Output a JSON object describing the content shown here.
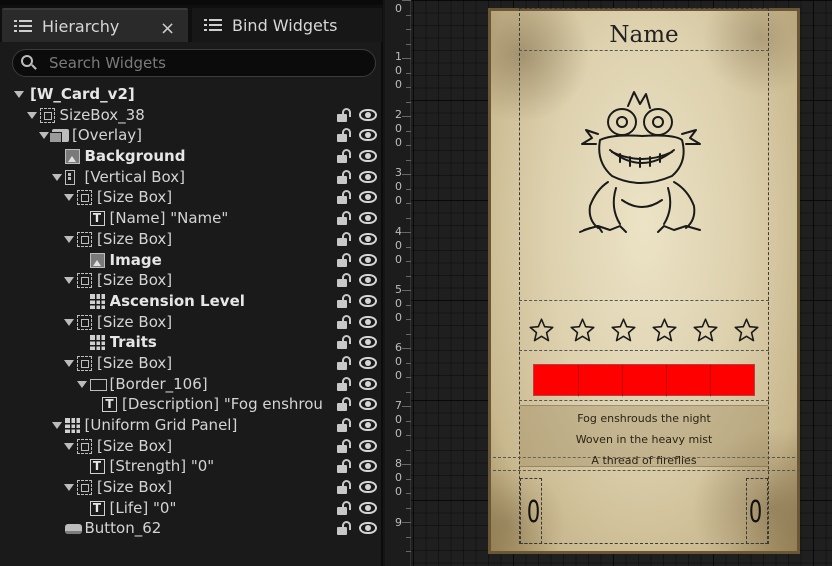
{
  "tabs": {
    "hierarchy": "Hierarchy",
    "bind_widgets": "Bind Widgets",
    "close_symbol": "×"
  },
  "search": {
    "placeholder": "Search Widgets"
  },
  "tree": [
    {
      "label": "[W_Card_v2]",
      "bold": true,
      "indent": 0,
      "icon": "",
      "arrow": true,
      "vis": false
    },
    {
      "label": "SizeBox_38",
      "bold": false,
      "indent": 1,
      "icon": "sizebox-icon",
      "arrow": true,
      "vis": true
    },
    {
      "label": "[Overlay]",
      "bold": false,
      "indent": 2,
      "icon": "overlay-icon",
      "arrow": true,
      "vis": true
    },
    {
      "label": "Background",
      "bold": true,
      "indent": 3,
      "icon": "image-icon",
      "arrow": false,
      "vis": true
    },
    {
      "label": "[Vertical Box]",
      "bold": false,
      "indent": 3,
      "icon": "vertical-box-icon",
      "arrow": true,
      "vis": true
    },
    {
      "label": "[Size Box]",
      "bold": false,
      "indent": 4,
      "icon": "sizebox-icon",
      "arrow": true,
      "vis": true
    },
    {
      "label": "[Name] \"Name\"",
      "bold": false,
      "indent": 5,
      "icon": "text-icon",
      "arrow": false,
      "vis": true
    },
    {
      "label": "[Size Box]",
      "bold": false,
      "indent": 4,
      "icon": "sizebox-icon",
      "arrow": true,
      "vis": true
    },
    {
      "label": "Image",
      "bold": true,
      "indent": 5,
      "icon": "image-icon",
      "arrow": false,
      "vis": true
    },
    {
      "label": "[Size Box]",
      "bold": false,
      "indent": 4,
      "icon": "sizebox-icon",
      "arrow": true,
      "vis": true
    },
    {
      "label": "Ascension Level",
      "bold": true,
      "indent": 5,
      "icon": "grid-icon",
      "arrow": false,
      "vis": true
    },
    {
      "label": "[Size Box]",
      "bold": false,
      "indent": 4,
      "icon": "sizebox-icon",
      "arrow": true,
      "vis": true
    },
    {
      "label": "Traits",
      "bold": true,
      "indent": 5,
      "icon": "grid-icon",
      "arrow": false,
      "vis": true
    },
    {
      "label": "[Size Box]",
      "bold": false,
      "indent": 4,
      "icon": "sizebox-icon",
      "arrow": true,
      "vis": true
    },
    {
      "label": "[Border_106]",
      "bold": false,
      "indent": 5,
      "icon": "border-icon",
      "arrow": true,
      "vis": true
    },
    {
      "label": "[Description] \"Fog enshrou",
      "bold": false,
      "indent": 6,
      "icon": "text-icon",
      "arrow": false,
      "vis": true
    },
    {
      "label": "[Uniform Grid Panel]",
      "bold": false,
      "indent": 3,
      "icon": "uniform-grid-icon",
      "arrow": true,
      "vis": true
    },
    {
      "label": "[Size Box]",
      "bold": false,
      "indent": 4,
      "icon": "sizebox-icon",
      "arrow": true,
      "vis": true
    },
    {
      "label": "[Strength] \"0\"",
      "bold": false,
      "indent": 5,
      "icon": "text-icon",
      "arrow": false,
      "vis": true
    },
    {
      "label": "[Size Box]",
      "bold": false,
      "indent": 4,
      "icon": "sizebox-icon",
      "arrow": true,
      "vis": true
    },
    {
      "label": "[Life] \"0\"",
      "bold": false,
      "indent": 5,
      "icon": "text-icon",
      "arrow": false,
      "vis": true
    },
    {
      "label": "Button_62",
      "bold": false,
      "indent": 3,
      "icon": "button-icon",
      "arrow": false,
      "vis": true
    }
  ],
  "ruler": [
    "0",
    "1",
    "0",
    "0",
    "2",
    "0",
    "0",
    "3",
    "0",
    "0",
    "4",
    "0",
    "0",
    "5",
    "0",
    "0",
    "6",
    "0",
    "0",
    "7",
    "0",
    "0",
    "8",
    "0",
    "0",
    "9"
  ],
  "card": {
    "name": "Name",
    "description": [
      "Fog enshrouds the night",
      "Woven in the heavy mist",
      "A thread of fireflies"
    ],
    "strength": "0",
    "life": "0"
  },
  "colors": {
    "accent_bar": "#ff0000",
    "panel_bg": "#1a1a1a"
  }
}
